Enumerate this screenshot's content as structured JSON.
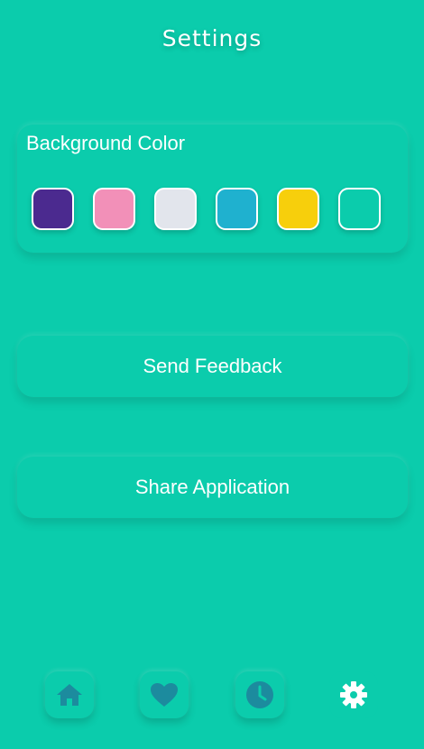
{
  "header": {
    "title": "Settings"
  },
  "background_color": {
    "label": "Background Color",
    "swatches": [
      "#4b2a8f",
      "#f290b8",
      "#e2e5ec",
      "#1fb1cf",
      "#f7cf0c",
      "#0bccac"
    ]
  },
  "actions": {
    "send_feedback": "Send Feedback",
    "share_application": "Share Application"
  },
  "bottom_nav": {
    "items": [
      {
        "icon": "home-icon",
        "active": false
      },
      {
        "icon": "heart-icon",
        "active": false
      },
      {
        "icon": "clock-icon",
        "active": false
      },
      {
        "icon": "gear-icon",
        "active": true
      }
    ],
    "icon_color": "#1c8b9e",
    "active_icon_color": "#ffffff"
  }
}
